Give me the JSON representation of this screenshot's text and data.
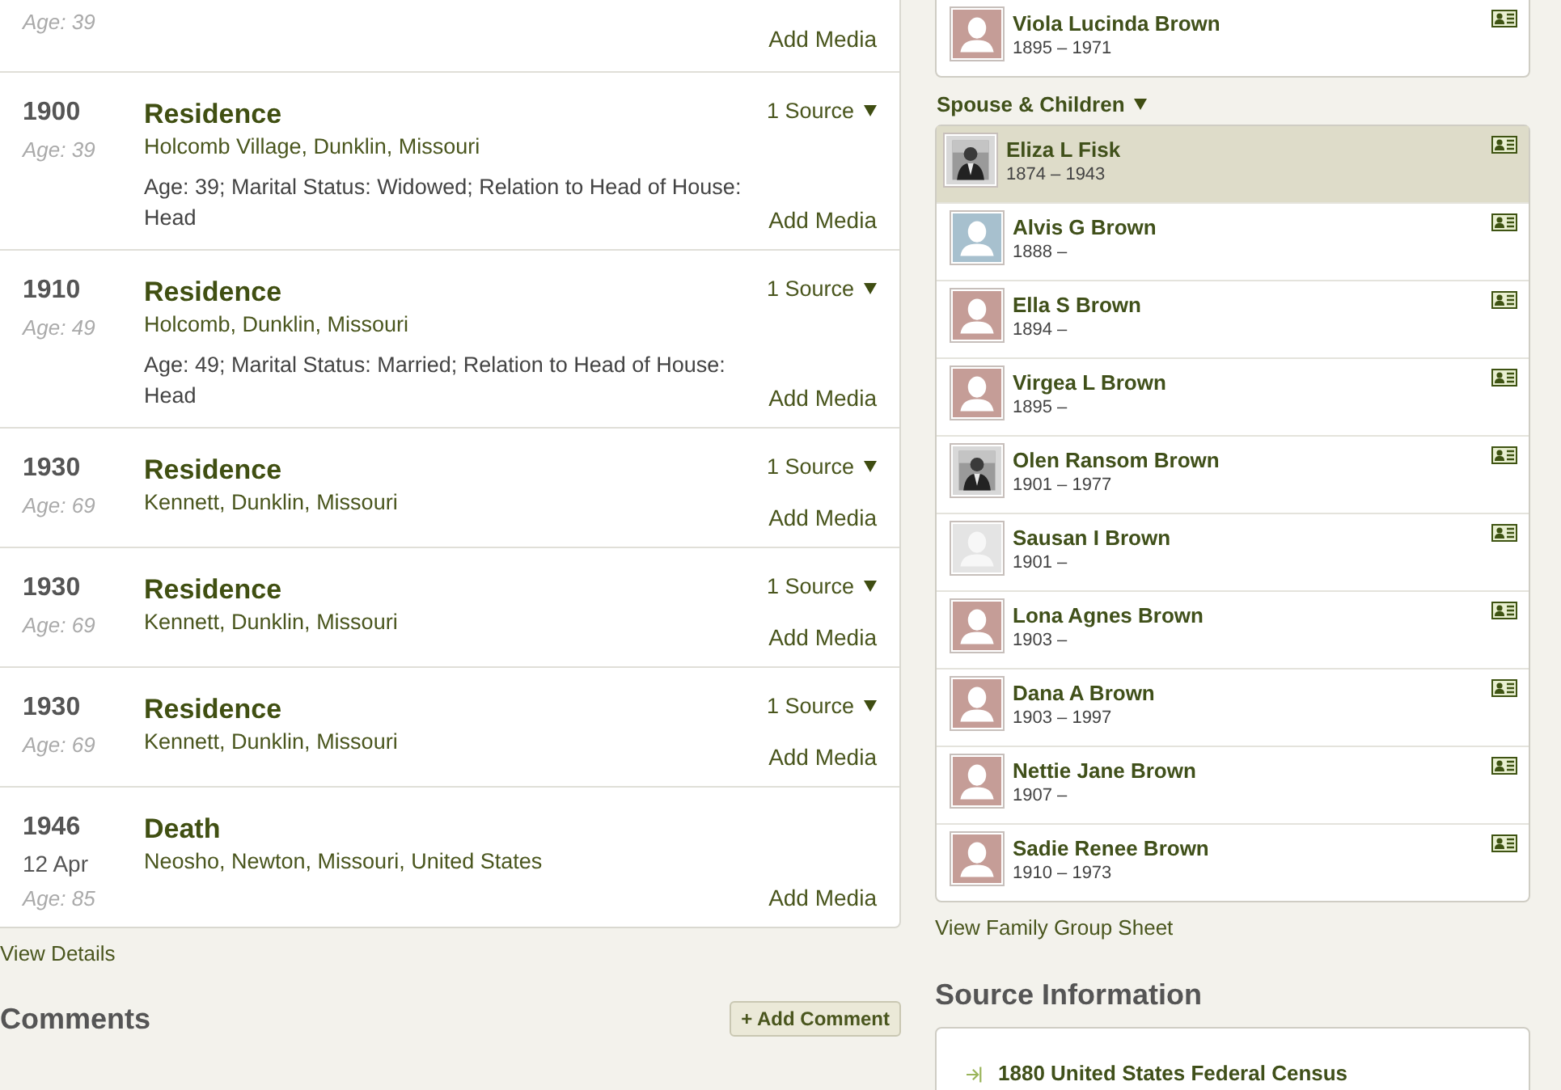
{
  "events": [
    {
      "age": "Age: 39",
      "add_media": "Add Media"
    },
    {
      "year": "1900",
      "age": "Age: 39",
      "title": "Residence",
      "place": "Holcomb Village, Dunklin, Missouri",
      "detail": "Age: 39; Marital Status: Widowed; Relation to Head of House: Head",
      "sources": "1 Source",
      "add_media": "Add Media"
    },
    {
      "year": "1910",
      "age": "Age: 49",
      "title": "Residence",
      "place": "Holcomb, Dunklin, Missouri",
      "detail": "Age: 49; Marital Status: Married; Relation to Head of House: Head",
      "sources": "1 Source",
      "add_media": "Add Media"
    },
    {
      "year": "1930",
      "age": "Age: 69",
      "title": "Residence",
      "place": "Kennett, Dunklin, Missouri",
      "sources": "1 Source",
      "add_media": "Add Media"
    },
    {
      "year": "1930",
      "age": "Age: 69",
      "title": "Residence",
      "place": "Kennett, Dunklin, Missouri",
      "sources": "1 Source",
      "add_media": "Add Media"
    },
    {
      "year": "1930",
      "age": "Age: 69",
      "title": "Residence",
      "place": "Kennett, Dunklin, Missouri",
      "sources": "1 Source",
      "add_media": "Add Media"
    },
    {
      "year": "1946",
      "date": "12 Apr",
      "age": "Age: 85",
      "title": "Death",
      "place": "Neosho, Newton, Missouri, United States",
      "add_media": "Add Media"
    }
  ],
  "view_details": "View Details",
  "comments": {
    "title": "Comments",
    "add_button": "+ Add Comment"
  },
  "parents_list": [
    {
      "name": "Viola Lucinda Brown",
      "dates": "1895 – 1971",
      "kind": "female",
      "selected": false
    }
  ],
  "family": {
    "title": "Spouse & Children",
    "members": [
      {
        "name": "Eliza L Fisk",
        "dates": "1874 – 1943",
        "selected": true
      },
      {
        "name": "Alvis G Brown",
        "dates": "1888 –",
        "kind": "male",
        "selected": false
      },
      {
        "name": "Ella S Brown",
        "dates": "1894 –",
        "kind": "female",
        "selected": false
      },
      {
        "name": "Virgea L Brown",
        "dates": "1895 –",
        "kind": "female",
        "selected": false
      },
      {
        "name": "Olen Ransom Brown",
        "dates": "1901 – 1977",
        "selected": false
      },
      {
        "name": "Sausan I Brown",
        "dates": "1901 –",
        "kind": "unknown",
        "selected": false
      },
      {
        "name": "Lona Agnes Brown",
        "dates": "1903 –",
        "kind": "female",
        "selected": false
      },
      {
        "name": "Dana A Brown",
        "dates": "1903 – 1997",
        "kind": "female",
        "selected": false
      },
      {
        "name": "Nettie Jane Brown",
        "dates": "1907 –",
        "kind": "female",
        "selected": false
      },
      {
        "name": "Sadie Renee Brown",
        "dates": "1910 – 1973",
        "kind": "female",
        "selected": false
      }
    ]
  },
  "view_group_sheet": "View Family Group Sheet",
  "source_info": {
    "title": "Source Information",
    "sources": [
      "1880 United States Federal Census"
    ]
  }
}
